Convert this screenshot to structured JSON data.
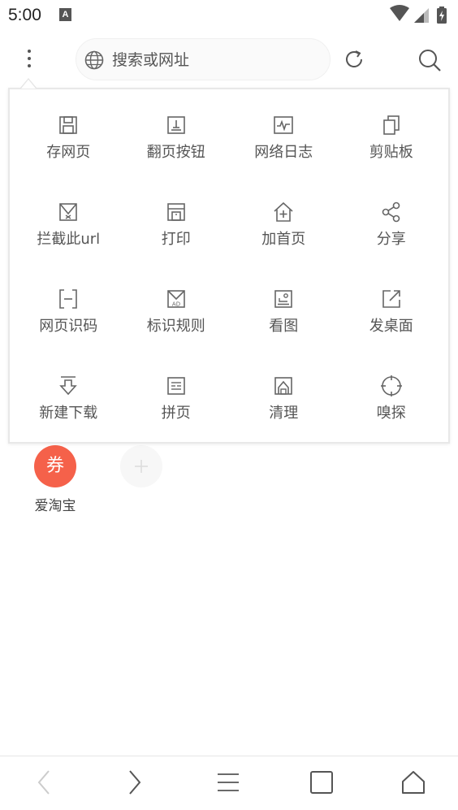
{
  "status_bar": {
    "time": "5:00",
    "notification_icon_letter": "A",
    "icons": [
      "wifi-icon",
      "signal-icon",
      "battery-charging-icon"
    ]
  },
  "toolbar": {
    "menu_icon": "more-vertical-icon",
    "search_placeholder": "搜索或网址",
    "globe_icon": "globe-icon",
    "refresh_icon": "refresh-icon",
    "search_icon": "search-icon"
  },
  "menu": {
    "items": [
      {
        "label": "存网页",
        "icon": "save-icon"
      },
      {
        "label": "翻页按钮",
        "icon": "page-button-icon"
      },
      {
        "label": "网络日志",
        "icon": "network-log-icon"
      },
      {
        "label": "剪贴板",
        "icon": "clipboard-icon"
      },
      {
        "label": "拦截此url",
        "icon": "block-url-icon"
      },
      {
        "label": "打印",
        "icon": "print-icon"
      },
      {
        "label": "加首页",
        "icon": "add-home-icon"
      },
      {
        "label": "分享",
        "icon": "share-icon"
      },
      {
        "label": "网页识码",
        "icon": "scan-code-icon"
      },
      {
        "label": "标识规则",
        "icon": "ad-rule-icon"
      },
      {
        "label": "看图",
        "icon": "image-icon"
      },
      {
        "label": "发桌面",
        "icon": "send-desktop-icon"
      },
      {
        "label": "新建下载",
        "icon": "download-icon"
      },
      {
        "label": "拼页",
        "icon": "merge-page-icon"
      },
      {
        "label": "清理",
        "icon": "clean-icon"
      },
      {
        "label": "嗅探",
        "icon": "sniff-icon"
      }
    ]
  },
  "shortcuts": [
    {
      "icon_text": "券",
      "label": "爱淘宝",
      "color": "#f5614a"
    }
  ],
  "add_shortcut_icon": "plus-icon",
  "bottom_nav": {
    "items": [
      "back-icon",
      "forward-icon",
      "menu-icon",
      "tabs-icon",
      "home-icon"
    ]
  }
}
